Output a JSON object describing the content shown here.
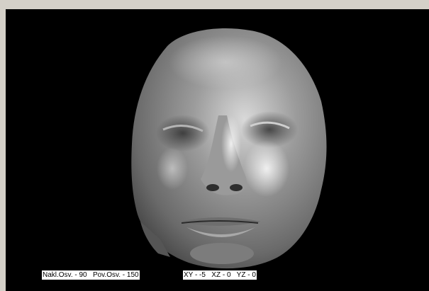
{
  "viewer": {
    "background_color": "#000000",
    "frame_color": "#d4d0c8",
    "model": {
      "subject": "3d-face-scan",
      "surface_color": "#8a8a8a"
    },
    "lighting_readout": "Nakl.Osv. - 90   Pov.Osv. - 150",
    "rotation_readout": "XY - -5   XZ - 0   YZ - 0"
  }
}
